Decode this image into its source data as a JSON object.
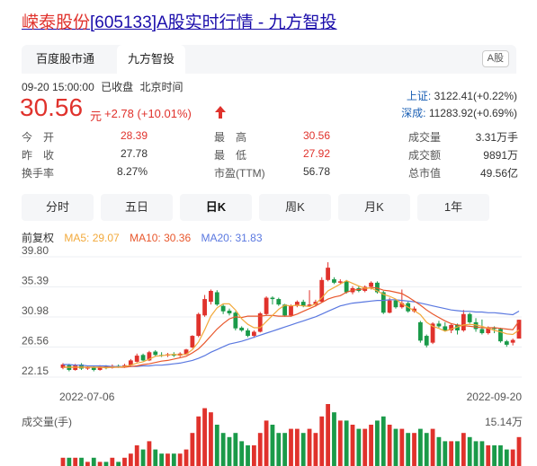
{
  "header": {
    "title_name": "嵘泰股份",
    "title_rest": "[605133]A股实时行情 - 九方智投"
  },
  "tabs": [
    {
      "label": "百度股市通",
      "active": false
    },
    {
      "label": "九方智投",
      "active": true
    }
  ],
  "market_badge": "A股",
  "quote": {
    "timestamp": "09-20 15:00:00",
    "status": "已收盘",
    "timezone": "北京时间",
    "price": "30.56",
    "unit": "元",
    "change": "+2.78",
    "change_pct": "(+10.01%)",
    "direction_icon": "up-arrow-icon"
  },
  "indices": [
    {
      "name": "上证:",
      "value": "3122.41(+0.22%)"
    },
    {
      "name": "深成:",
      "value": "11283.92(+0.69%)"
    }
  ],
  "stats": [
    {
      "label": "今　开",
      "value": "28.39",
      "color": "red"
    },
    {
      "label": "最　高",
      "value": "30.56",
      "color": "red"
    },
    {
      "label": "成交量",
      "value": "3.31万手",
      "color": "dark"
    },
    {
      "label": "昨　收",
      "value": "27.78",
      "color": "dark"
    },
    {
      "label": "最　低",
      "value": "27.92",
      "color": "red"
    },
    {
      "label": "成交额",
      "value": "9891万",
      "color": "dark"
    },
    {
      "label": "换手率",
      "value": "8.27%",
      "color": "dark"
    },
    {
      "label": "市盈(TTM)",
      "value": "56.78",
      "color": "dark"
    },
    {
      "label": "总市值",
      "value": "49.56亿",
      "color": "dark"
    }
  ],
  "periods": [
    {
      "label": "分时",
      "active": false
    },
    {
      "label": "五日",
      "active": false
    },
    {
      "label": "日K",
      "active": true
    },
    {
      "label": "周K",
      "active": false
    },
    {
      "label": "月K",
      "active": false
    },
    {
      "label": "1年",
      "active": false
    }
  ],
  "ma_line": {
    "adjust": "前复权",
    "ma5": "MA5: 29.07",
    "ma10": "MA10: 30.36",
    "ma20": "MA20: 31.83"
  },
  "colors": {
    "up": "#e0322c",
    "down": "#1a9a49",
    "ma5": "#f2a93b",
    "ma10": "#e8572c",
    "ma20": "#5a78e0",
    "link": "#1a0dab"
  },
  "chart_data": {
    "type": "candlestick",
    "y_ticks": [
      "39.80",
      "35.39",
      "30.98",
      "26.56",
      "22.15"
    ],
    "ylim": [
      22.15,
      39.8
    ],
    "x_start_label": "2022-07-06",
    "x_end_label": "2022-09-20",
    "grid": true,
    "candles": [
      [
        23.5,
        24.0,
        24.2,
        23.3
      ],
      [
        23.9,
        23.2,
        24.1,
        23.0
      ],
      [
        23.2,
        23.9,
        24.1,
        23.1
      ],
      [
        24.0,
        23.4,
        24.2,
        23.2
      ],
      [
        23.4,
        23.6,
        23.8,
        23.2
      ],
      [
        23.6,
        23.2,
        23.8,
        23.0
      ],
      [
        23.2,
        23.7,
        23.9,
        23.1
      ],
      [
        23.7,
        23.5,
        23.9,
        23.3
      ],
      [
        23.5,
        23.8,
        24.0,
        23.4
      ],
      [
        23.8,
        23.6,
        24.0,
        23.5
      ],
      [
        23.6,
        23.9,
        24.1,
        23.5
      ],
      [
        23.9,
        24.6,
        24.8,
        23.8
      ],
      [
        24.4,
        25.3,
        25.6,
        24.3
      ],
      [
        25.4,
        24.6,
        25.6,
        24.5
      ],
      [
        24.6,
        25.8,
        26.0,
        24.5
      ],
      [
        25.9,
        25.4,
        26.1,
        25.2
      ],
      [
        25.4,
        25.3,
        25.8,
        25.1
      ],
      [
        25.3,
        25.5,
        25.7,
        25.1
      ],
      [
        25.5,
        25.3,
        25.8,
        25.1
      ],
      [
        25.3,
        25.6,
        25.8,
        25.1
      ],
      [
        25.5,
        26.2,
        26.3,
        25.4
      ],
      [
        26.5,
        28.2,
        28.3,
        26.4
      ],
      [
        28.2,
        31.4,
        31.6,
        28.0
      ],
      [
        31.2,
        33.6,
        34.2,
        31.0
      ],
      [
        33.2,
        34.8,
        35.0,
        32.8
      ],
      [
        34.6,
        32.8,
        34.9,
        32.6
      ],
      [
        32.6,
        31.8,
        32.8,
        31.4
      ],
      [
        31.9,
        31.5,
        32.2,
        31.2
      ],
      [
        31.6,
        29.3,
        31.8,
        29.0
      ],
      [
        29.4,
        29.0,
        29.6,
        28.8
      ],
      [
        29.0,
        28.2,
        29.3,
        28.0
      ],
      [
        28.2,
        28.8,
        29.0,
        27.9
      ],
      [
        28.8,
        31.5,
        31.7,
        28.7
      ],
      [
        31.4,
        33.8,
        34.0,
        31.2
      ],
      [
        33.8,
        33.6,
        34.0,
        32.8
      ],
      [
        33.6,
        32.8,
        33.8,
        32.6
      ],
      [
        32.8,
        31.2,
        32.9,
        31.0
      ],
      [
        31.2,
        32.6,
        32.8,
        31.0
      ],
      [
        32.6,
        33.2,
        33.4,
        32.4
      ],
      [
        33.2,
        32.6,
        33.5,
        32.4
      ],
      [
        32.6,
        32.8,
        34.9,
        32.5
      ],
      [
        32.8,
        33.2,
        33.5,
        32.5
      ],
      [
        33.2,
        36.4,
        36.8,
        33.1
      ],
      [
        36.4,
        38.2,
        39.0,
        36.2
      ],
      [
        36.5,
        36.0,
        36.8,
        35.8
      ],
      [
        36.0,
        36.2,
        36.5,
        35.8
      ],
      [
        36.2,
        34.6,
        36.4,
        34.4
      ],
      [
        34.6,
        35.2,
        35.5,
        34.3
      ],
      [
        35.2,
        34.8,
        35.5,
        34.6
      ],
      [
        34.8,
        35.4,
        35.6,
        34.6
      ],
      [
        35.4,
        36.0,
        36.2,
        35.0
      ],
      [
        36.0,
        34.6,
        36.2,
        34.4
      ],
      [
        34.6,
        31.6,
        34.8,
        31.4
      ],
      [
        31.6,
        33.4,
        33.8,
        31.5
      ],
      [
        33.4,
        32.4,
        33.6,
        32.2
      ],
      [
        32.4,
        33.0,
        35.0,
        32.2
      ],
      [
        33.0,
        31.8,
        33.2,
        31.6
      ],
      [
        31.8,
        32.2,
        32.5,
        31.6
      ],
      [
        30.2,
        27.5,
        30.4,
        27.2
      ],
      [
        28.2,
        26.8,
        28.4,
        26.5
      ],
      [
        27.2,
        30.0,
        30.2,
        27.0
      ],
      [
        30.0,
        29.6,
        30.4,
        29.4
      ],
      [
        29.6,
        29.0,
        30.2,
        28.8
      ],
      [
        29.0,
        29.8,
        30.0,
        28.6
      ],
      [
        29.8,
        29.0,
        30.0,
        28.4
      ],
      [
        29.0,
        31.4,
        32.0,
        28.8
      ],
      [
        31.4,
        30.2,
        31.6,
        30.0
      ],
      [
        30.2,
        29.2,
        30.8,
        28.8
      ],
      [
        29.2,
        28.6,
        30.6,
        28.4
      ],
      [
        28.6,
        29.4,
        29.6,
        28.4
      ],
      [
        29.4,
        29.2,
        29.6,
        28.6
      ],
      [
        29.2,
        27.4,
        29.4,
        27.2
      ],
      [
        27.4,
        26.9,
        27.6,
        26.6
      ],
      [
        27.2,
        27.6,
        27.8,
        26.8
      ],
      [
        27.8,
        30.56,
        30.56,
        27.92
      ]
    ],
    "ma5": [
      23.6,
      23.6,
      23.6,
      23.6,
      23.6,
      23.6,
      23.6,
      23.5,
      23.6,
      23.6,
      23.7,
      23.9,
      24.2,
      24.4,
      24.8,
      25.2,
      25.3,
      25.4,
      25.5,
      25.4,
      25.5,
      26.2,
      27.3,
      29.1,
      31.1,
      32.3,
      32.9,
      32.9,
      32.0,
      30.7,
      29.9,
      29.4,
      29.4,
      30.3,
      31.2,
      32.1,
      32.7,
      32.6,
      32.7,
      32.6,
      32.5,
      32.9,
      33.8,
      34.8,
      35.3,
      35.8,
      36.3,
      35.9,
      35.5,
      35.2,
      35.2,
      34.8,
      34.3,
      34.0,
      33.6,
      32.9,
      32.4,
      31.9,
      31.3,
      30.2,
      29.6,
      29.3,
      28.9,
      29.2,
      29.5,
      29.8,
      29.9,
      29.8,
      29.6,
      29.3,
      29.0,
      28.8,
      28.5,
      28.4,
      29.07
    ],
    "ma10": [
      23.6,
      23.6,
      23.6,
      23.6,
      23.6,
      23.6,
      23.6,
      23.6,
      23.6,
      23.6,
      23.6,
      23.7,
      23.8,
      24.0,
      24.1,
      24.3,
      24.5,
      24.6,
      24.8,
      25.0,
      25.2,
      25.7,
      26.3,
      27.2,
      28.2,
      29.2,
      30.0,
      30.7,
      31.0,
      30.9,
      31.1,
      31.1,
      31.1,
      31.2,
      31.2,
      31.1,
      31.1,
      31.1,
      31.4,
      31.8,
      32.2,
      32.6,
      33.1,
      33.6,
      33.9,
      34.1,
      34.6,
      34.9,
      35.0,
      35.1,
      35.3,
      35.2,
      34.9,
      34.8,
      34.6,
      34.4,
      33.9,
      33.3,
      32.7,
      32.0,
      31.4,
      30.9,
      30.4,
      30.0,
      29.8,
      29.7,
      29.6,
      29.5,
      29.4,
      29.4,
      29.4,
      29.3,
      29.2,
      29.1,
      30.36
    ],
    "ma20": [
      24.0,
      24.0,
      23.9,
      23.9,
      23.8,
      23.8,
      23.8,
      23.8,
      23.7,
      23.7,
      23.7,
      23.7,
      23.7,
      23.8,
      23.8,
      23.9,
      23.9,
      24.0,
      24.1,
      24.2,
      24.4,
      24.6,
      24.9,
      25.3,
      25.8,
      26.2,
      26.6,
      27.0,
      27.2,
      27.4,
      27.7,
      28.0,
      28.3,
      28.6,
      28.9,
      29.2,
      29.5,
      29.8,
      30.1,
      30.4,
      30.7,
      31.0,
      31.4,
      31.8,
      32.2,
      32.6,
      32.8,
      33.0,
      33.1,
      33.2,
      33.3,
      33.4,
      33.4,
      33.5,
      33.5,
      33.4,
      33.3,
      33.2,
      33.0,
      32.8,
      32.6,
      32.4,
      32.2,
      32.0,
      31.9,
      31.8,
      31.8,
      31.7,
      31.7,
      31.6,
      31.6,
      31.5,
      31.4,
      31.3,
      31.83
    ],
    "volume_label": "成交量(手)",
    "volume_max": "15.14万",
    "volumes": [
      2,
      2,
      2,
      2,
      1,
      2,
      1,
      1,
      2,
      1,
      2,
      3,
      5,
      4,
      6,
      4,
      3,
      3,
      3,
      3,
      4,
      8,
      12,
      14,
      13,
      10,
      8,
      7,
      8,
      6,
      5,
      5,
      8,
      11,
      10,
      8,
      8,
      9,
      9,
      8,
      9,
      8,
      12,
      15,
      13,
      11,
      11,
      10,
      9,
      9,
      10,
      11,
      12,
      10,
      9,
      9,
      8,
      8,
      9,
      8,
      9,
      7,
      6,
      6,
      6,
      8,
      7,
      6,
      6,
      5,
      5,
      5,
      4,
      4,
      7
    ]
  }
}
